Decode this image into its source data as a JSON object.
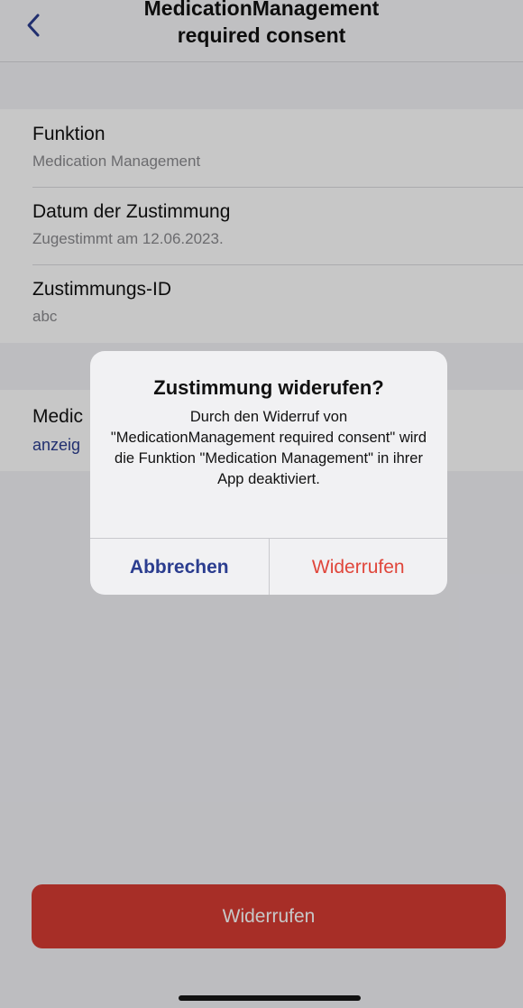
{
  "navbar": {
    "title_line1": "MedicationManagement",
    "title_line2": "required consent",
    "back_icon": "chevron-left-icon"
  },
  "details": [
    {
      "label": "Funktion",
      "value": "Medication Management"
    },
    {
      "label": "Datum der Zustimmung",
      "value": "Zugestimmt am 12.06.2023."
    },
    {
      "label": "Zustimmungs-ID",
      "value": "abc"
    }
  ],
  "section2": {
    "label": "Medic",
    "link": "anzeig"
  },
  "footer": {
    "revoke_label": "Widerrufen"
  },
  "alert": {
    "title": "Zustimmung widerufen?",
    "message": "Durch den Widerruf von \"MedicationManagement required consent\" wird die Funktion \"Medication Management\" in ihrer App deaktiviert.",
    "cancel_label": "Abbrechen",
    "confirm_label": "Widerrufen"
  },
  "colors": {
    "accent": "#2b3d8f",
    "destructive": "#e0463b",
    "button_bg": "#d63c32"
  }
}
